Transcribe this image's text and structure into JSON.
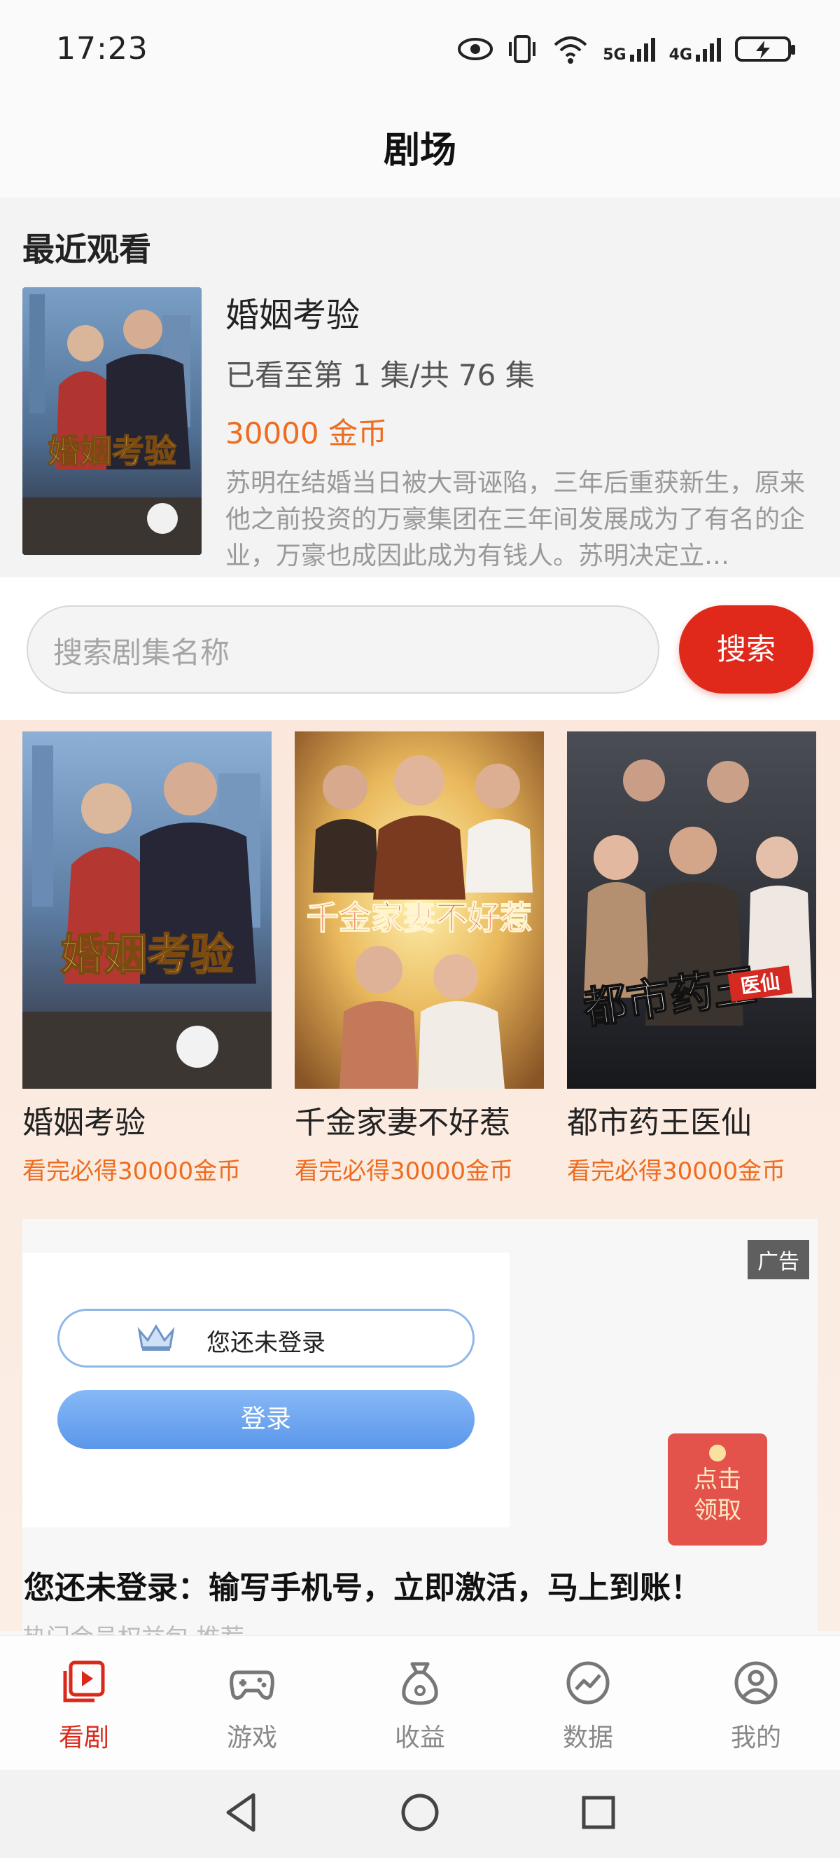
{
  "status_bar": {
    "time": "17:23",
    "signal1_label": "5G",
    "signal2_label": "4G",
    "icons": [
      "eye-icon",
      "vibrate-icon",
      "wifi-icon",
      "signal-5g-icon",
      "signal-4g-icon",
      "battery-charging-icon"
    ]
  },
  "header": {
    "title": "剧场"
  },
  "recent": {
    "heading": "最近观看",
    "title": "婚姻考验",
    "progress": "已看至第 1 集/共 76 集",
    "coins": "30000 金币",
    "description": "苏明在结婚当日被大哥诬陷，三年后重获新生，原来他之前投资的万豪集团在三年间发展成为了有名的企业，万豪也成因此成为有钱人。苏明决定立…"
  },
  "search": {
    "placeholder": "搜索剧集名称",
    "button_label": "搜索"
  },
  "dramas": [
    {
      "title": "婚姻考验",
      "reward": "看完必得30000金币",
      "poster_text": "婚姻考验"
    },
    {
      "title": "千金家妻不好惹",
      "reward": "看完必得30000金币",
      "poster_text": "千金家妻不好惹"
    },
    {
      "title": "都市药王医仙",
      "reward": "看完必得30000金币",
      "poster_text": "都市药王",
      "poster_tag": "医仙"
    }
  ],
  "ad": {
    "badge": "广告",
    "login_status": "您还未登录",
    "login_button": "登录",
    "red_pack_line1": "点击",
    "red_pack_line2": "领取",
    "caption": "您还未登录：输写手机号，立即激活，马上到账！",
    "more": "热门会员权益包 推荐"
  },
  "tabs": [
    {
      "label": "看剧",
      "icon": "play-video-icon",
      "active": true
    },
    {
      "label": "游戏",
      "icon": "gamepad-icon",
      "active": false
    },
    {
      "label": "收益",
      "icon": "money-bag-icon",
      "active": false
    },
    {
      "label": "数据",
      "icon": "trend-chart-icon",
      "active": false
    },
    {
      "label": "我的",
      "icon": "user-profile-icon",
      "active": false
    }
  ],
  "colors": {
    "accent_red": "#e0281b",
    "coin_orange": "#ef6c1f",
    "tab_active": "#d9291b"
  }
}
